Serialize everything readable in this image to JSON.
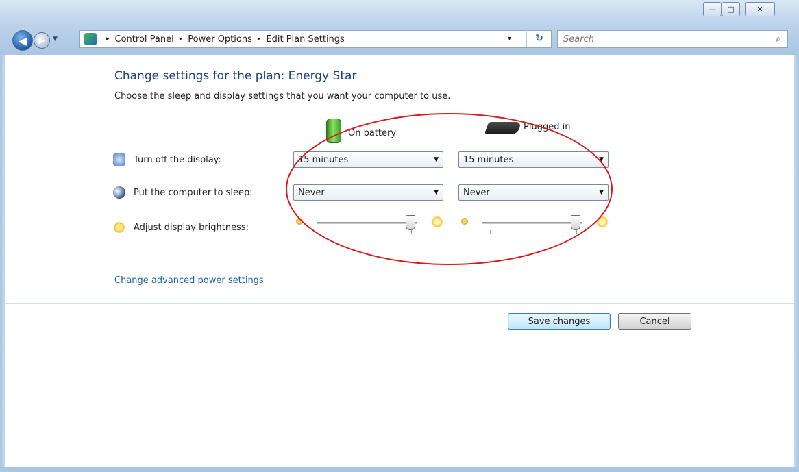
{
  "window": {
    "controls": {
      "minimize": "—",
      "maximize": "□",
      "close": "✕"
    }
  },
  "nav": {
    "back_icon": "back-arrow-icon",
    "forward_icon": "forward-arrow-icon"
  },
  "address": {
    "crumbs": [
      "Control Panel",
      "Power Options",
      "Edit Plan Settings"
    ],
    "separator": "▸",
    "dropdown": "▾",
    "refresh": "↻"
  },
  "search": {
    "placeholder": "Search",
    "icon": "⌕"
  },
  "main": {
    "title": "Change settings for the plan: Energy Star",
    "subtitle": "Choose the sleep and display settings that you want your computer to use.",
    "columns": {
      "battery": "On battery",
      "plugged": "Plugged in"
    },
    "rows": {
      "display": {
        "label": "Turn off the display:",
        "battery": "15 minutes",
        "plugged": "15 minutes"
      },
      "sleep": {
        "label": "Put the computer to sleep:",
        "battery": "Never",
        "plugged": "Never"
      },
      "brightness": {
        "label": "Adjust display brightness:",
        "battery_level": 1.0,
        "plugged_level": 1.0
      }
    },
    "advanced_link": "Change advanced power settings"
  },
  "buttons": {
    "save": "Save changes",
    "cancel": "Cancel"
  },
  "colors": {
    "accent": "#1e3f7a",
    "link": "#1f5fb0",
    "annotation": "#d81a1a"
  }
}
